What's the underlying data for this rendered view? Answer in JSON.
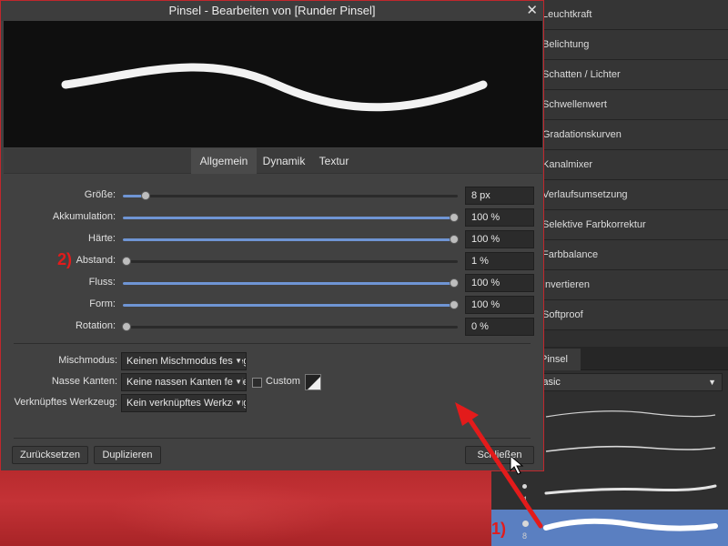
{
  "dialog": {
    "title": "Pinsel - Bearbeiten von [Runder Pinsel]",
    "close_glyph": "✕",
    "tabs": [
      "Allgemein",
      "Dynamik",
      "Textur"
    ],
    "active_tab": "Allgemein",
    "sliders": [
      {
        "label": "Größe:",
        "value": "8 px",
        "level": 0.07
      },
      {
        "label": "Akkumulation:",
        "value": "100 %",
        "level": 1.0
      },
      {
        "label": "Härte:",
        "value": "100 %",
        "level": 1.0
      },
      {
        "label": "Abstand:",
        "value": "1 %",
        "level": 0.01
      },
      {
        "label": "Fluss:",
        "value": "100 %",
        "level": 1.0
      },
      {
        "label": "Form:",
        "value": "100 %",
        "level": 1.0
      },
      {
        "label": "Rotation:",
        "value": "0 %",
        "level": 0.0
      }
    ],
    "mischmodus": {
      "label": "Mischmodus:",
      "value": "Keinen Mischmodus festlegen"
    },
    "nasse_kanten": {
      "label": "Nasse Kanten:",
      "value": "Keine nassen Kanten festlegen",
      "custom_label": "Custom"
    },
    "werkzeug": {
      "label": "Verknüpftes Werkzeug:",
      "value": "Kein verknüpftes Werkzeug"
    },
    "buttons": {
      "reset": "Zurücksetzen",
      "duplicate": "Duplizieren",
      "close": "Schließen"
    }
  },
  "adjustments": {
    "items": [
      "Leuchtkraft",
      "Belichtung",
      "Schatten / Lichter",
      "Schwellenwert",
      "Gradationskurven",
      "Kanalmixer",
      "Verlaufsumsetzung",
      "Selektive Farbkorrektur",
      "Farbbalance",
      "Invertieren",
      "Softproof"
    ]
  },
  "brushes_panel": {
    "tab_label": "Pinsel",
    "category_value": "Basic",
    "brush_sizes": [
      "",
      "",
      "4",
      "8"
    ],
    "selected_index": 3
  },
  "annotations": {
    "step1": "1)",
    "step2": "2)"
  },
  "colors": {
    "accent": "#5a7fc1",
    "annotation": "#e31b1b",
    "canvas": "#b42a2c"
  }
}
